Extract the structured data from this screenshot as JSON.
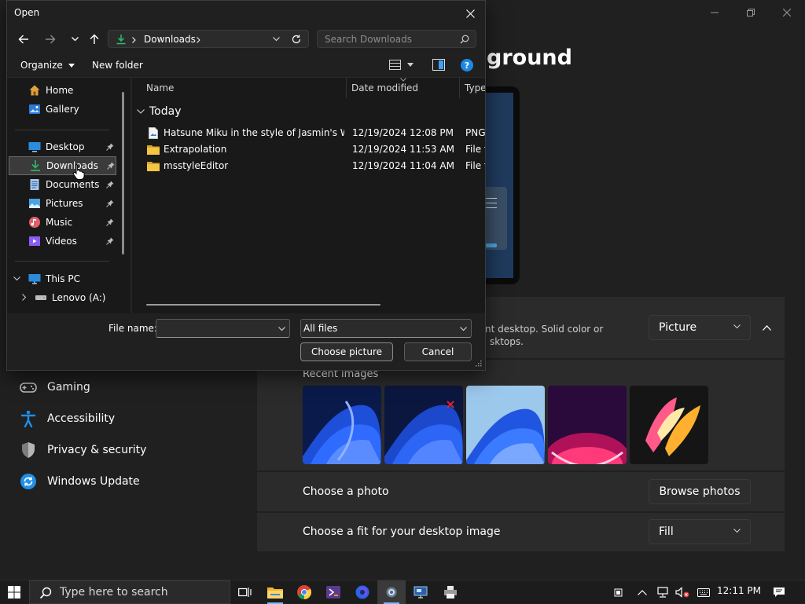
{
  "settings": {
    "heading_partial": "ground",
    "nav": [
      {
        "label": "Gaming",
        "icon": "gamepad-icon"
      },
      {
        "label": "Accessibility",
        "icon": "accessibility-icon"
      },
      {
        "label": "Privacy & security",
        "icon": "shield-icon"
      },
      {
        "label": "Windows Update",
        "icon": "update-icon"
      }
    ],
    "personalize": {
      "desc_line1": "nt desktop. Solid color or",
      "desc_line2": "sktops.",
      "type_value": "Picture",
      "recent_images_label": "Recent images",
      "choose_photo_label": "Choose a photo",
      "browse_button": "Browse photos",
      "fit_label": "Choose a fit for your desktop image",
      "fit_value": "Fill"
    }
  },
  "dialog": {
    "title": "Open",
    "breadcrumb": "Downloads",
    "search_placeholder": "Search Downloads",
    "toolbar": {
      "organize": "Organize",
      "new_folder": "New folder"
    },
    "tree": [
      {
        "label": "Home",
        "icon": "home-icon",
        "pinned": false
      },
      {
        "label": "Gallery",
        "icon": "gallery-icon",
        "pinned": false
      },
      {
        "label": "Desktop",
        "icon": "desktop-icon",
        "pinned": true
      },
      {
        "label": "Downloads",
        "icon": "downloads-icon",
        "pinned": true,
        "selected": true
      },
      {
        "label": "Documents",
        "icon": "documents-icon",
        "pinned": true
      },
      {
        "label": "Pictures",
        "icon": "pictures-icon",
        "pinned": true
      },
      {
        "label": "Music",
        "icon": "music-icon",
        "pinned": true
      },
      {
        "label": "Videos",
        "icon": "videos-icon",
        "pinned": true
      },
      {
        "label": "This PC",
        "icon": "this-pc-icon",
        "pinned": false
      },
      {
        "label": "Lenovo (A:)",
        "icon": "drive-icon",
        "pinned": false
      }
    ],
    "columns": {
      "name": "Name",
      "date": "Date modified",
      "type": "Type"
    },
    "group_label": "Today",
    "files": [
      {
        "name": "Hatsune Miku in the style of Jasmin's Wo...",
        "date": "12/19/2024 12:08 PM",
        "type": "PNG",
        "icon": "image-file-icon"
      },
      {
        "name": "Extrapolation",
        "date": "12/19/2024 11:53 AM",
        "type": "File fo",
        "icon": "folder-icon"
      },
      {
        "name": "msstyleEditor",
        "date": "12/19/2024 11:04 AM",
        "type": "File fo",
        "icon": "folder-icon"
      }
    ],
    "filename_label": "File name:",
    "filename_value": "",
    "filter_value": "All files",
    "choose_button": "Choose picture",
    "cancel_button": "Cancel"
  },
  "taskbar": {
    "search_placeholder": "Type here to search",
    "clock": "12:11 PM"
  },
  "colors": {
    "accent": "#0078d4",
    "downloads_green": "#2fb36b",
    "folder_yellow": "#f4c542"
  }
}
